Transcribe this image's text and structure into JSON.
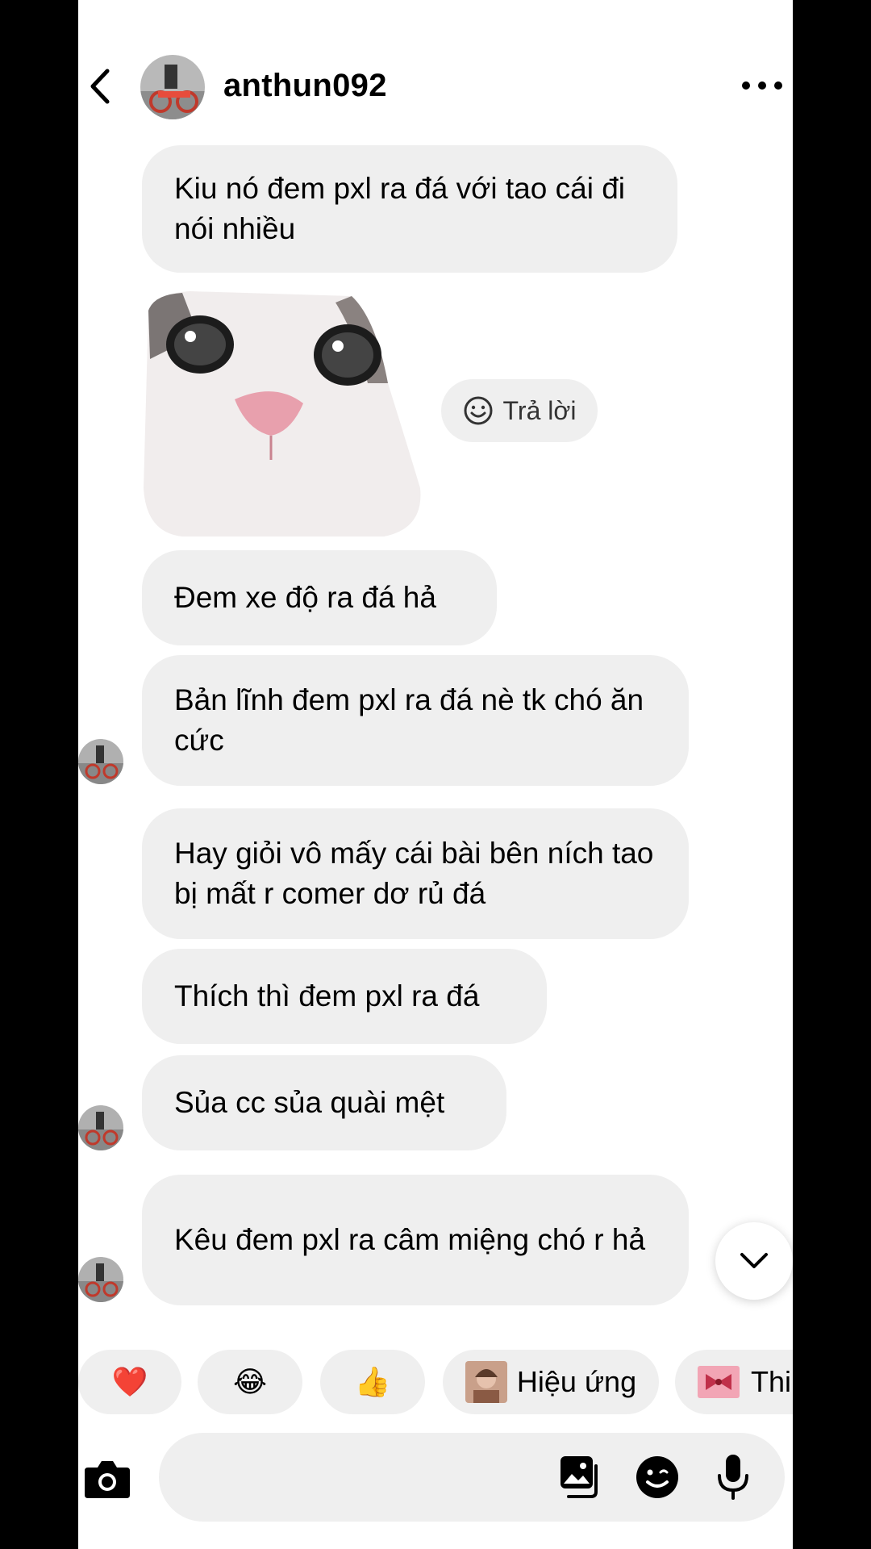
{
  "header": {
    "username": "anthun092"
  },
  "messages": [
    {
      "text": "Kiu nó đem pxl ra đá với tao cái đi nói nhiều"
    },
    {
      "text": "Đem xe độ ra đá hả"
    },
    {
      "text": "Bản lĩnh đem pxl ra đá nè tk chó ăn cức"
    },
    {
      "text": "Hay giỏi vô mấy cái bài bên ních tao bị mất r comer dơ rủ đá"
    },
    {
      "text": "Thích thì đem pxl ra đá"
    },
    {
      "text": "Sủa cc sủa quài mệt"
    },
    {
      "text": "Kêu đem pxl ra câm miệng chó r hả"
    }
  ],
  "reply_label": "Trả lời",
  "quick_reactions": [
    {
      "icon": "red-heart-icon",
      "glyph": "❤️"
    },
    {
      "icon": "tears-of-joy-icon",
      "glyph": "😂"
    },
    {
      "icon": "thumbs-up-icon",
      "glyph": "👍"
    }
  ],
  "effects_chip": {
    "label": "Hiệu ứng"
  },
  "theme_chip": {
    "label": "Thi"
  },
  "icons": [
    "back-chevron-icon",
    "more-options-icon",
    "scroll-down-icon",
    "camera-icon",
    "gallery-icon",
    "sticker-icon",
    "microphone-icon"
  ],
  "colors": {
    "bubble": "#efefef",
    "background": "#ffffff",
    "text": "#000000"
  }
}
